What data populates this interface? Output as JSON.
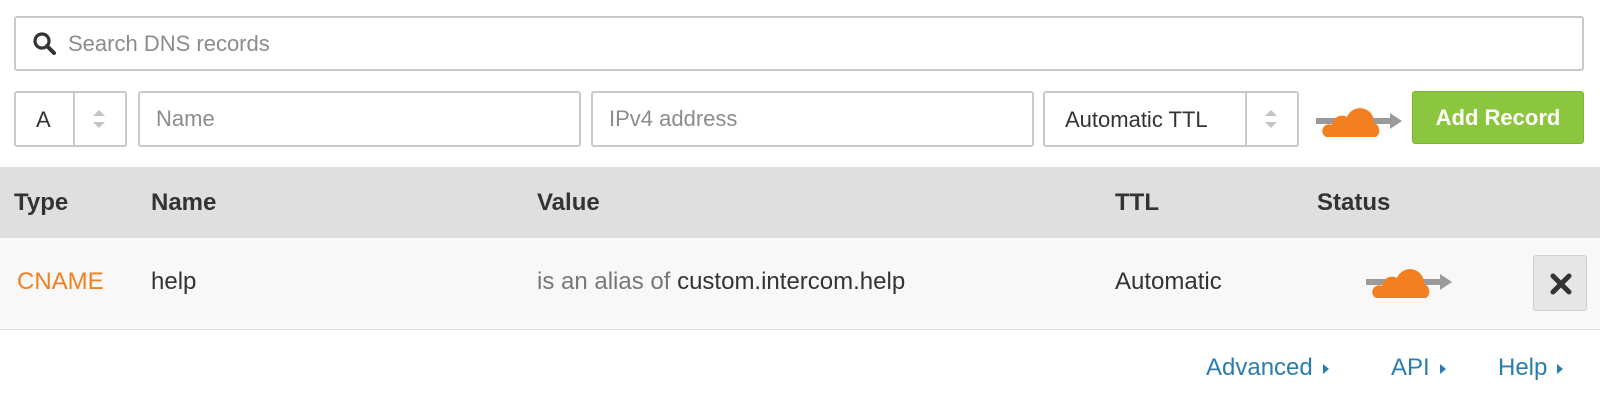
{
  "search": {
    "placeholder": "Search DNS records",
    "icon": "search-icon"
  },
  "form": {
    "type_value": "A",
    "name_placeholder": "Name",
    "value_placeholder": "IPv4 address",
    "ttl_value": "Automatic TTL",
    "proxy_icon": "cloud-proxied-icon",
    "add_button_label": "Add Record"
  },
  "table": {
    "headers": [
      "Type",
      "Name",
      "Value",
      "TTL",
      "Status"
    ],
    "rows": [
      {
        "type": "CNAME",
        "name": "help",
        "value_prefix": "is an alias of",
        "value": "custom.intercom.help",
        "ttl": "Automatic",
        "status_icon": "cloud-proxied-icon"
      }
    ]
  },
  "footer": {
    "links": [
      "Advanced",
      "API",
      "Help"
    ]
  },
  "colors": {
    "accent_orange": "#f38020",
    "add_button_green": "#8cc63e",
    "link_blue": "#2c7cb0",
    "header_bg": "#dfdfdf"
  }
}
